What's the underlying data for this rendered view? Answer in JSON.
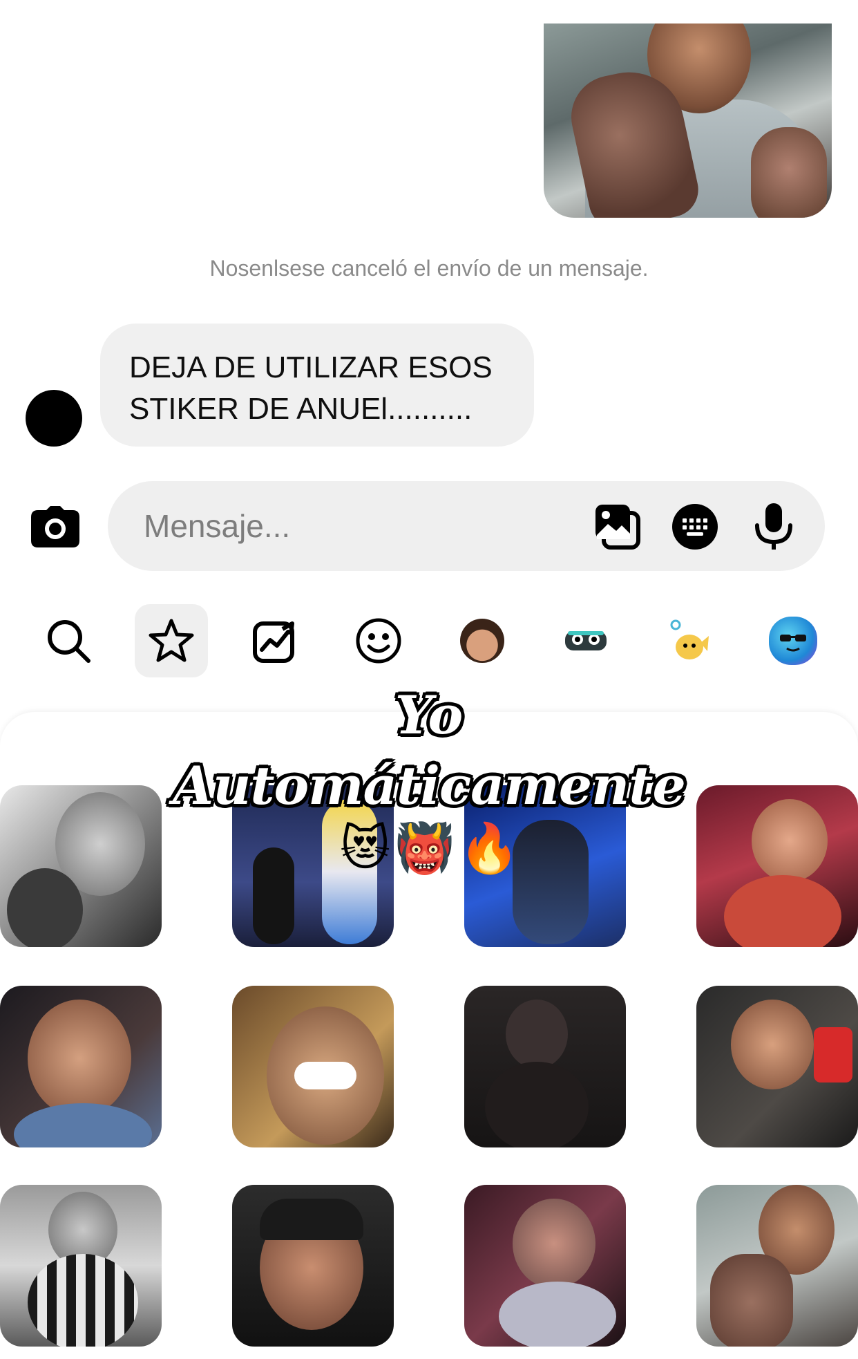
{
  "conversation": {
    "system_note": "Nosenlsese canceló el envío de un mensaje.",
    "incoming_message": "DEJA DE UTILIZAR ESOS STIKER DE ANUEl.........."
  },
  "composer": {
    "placeholder": "Mensaje..."
  },
  "tray": {
    "items": [
      "search-icon",
      "star-icon",
      "trending-icon",
      "smiley-icon",
      "avatar-face-icon",
      "monster-icon",
      "fish-icon",
      "blob-icon"
    ]
  },
  "overlay": {
    "line1": "Yo",
    "line2": "Automáticamente",
    "emojis": [
      "😻",
      "👹",
      "🔥"
    ]
  },
  "colors": {
    "bubble": "#f0f0f0",
    "composer": "#efefef",
    "system_text": "#8a8a8a",
    "tray_active": "#efefef"
  }
}
